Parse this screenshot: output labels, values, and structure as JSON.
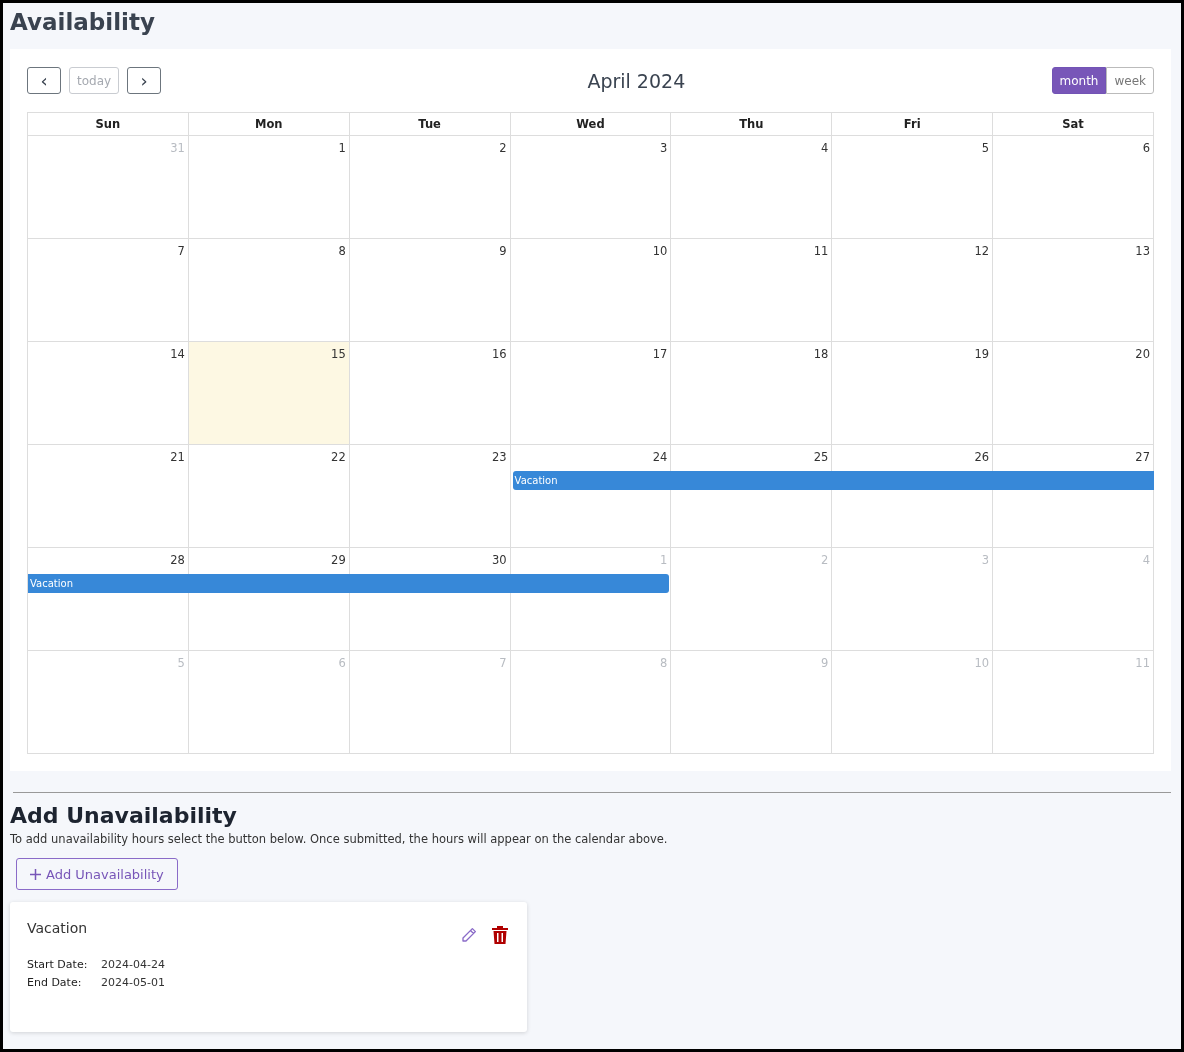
{
  "title": "Availability",
  "calendar": {
    "title": "April 2024",
    "prev_button": "‹",
    "today_button": {
      "label": "today",
      "disabled": true
    },
    "next_button": "›",
    "views": [
      {
        "label": "month",
        "selected": true
      },
      {
        "label": "week",
        "selected": false
      }
    ],
    "weekdays": [
      "Sun",
      "Mon",
      "Tue",
      "Wed",
      "Thu",
      "Fri",
      "Sat"
    ],
    "weeks": [
      {
        "days": [
          {
            "label": "31",
            "other_month": true,
            "today": false,
            "booked": false
          },
          {
            "label": "1",
            "other_month": false,
            "today": false,
            "booked": false
          },
          {
            "label": "2",
            "other_month": false,
            "today": false,
            "booked": false
          },
          {
            "label": "3",
            "other_month": false,
            "today": false,
            "booked": false
          },
          {
            "label": "4",
            "other_month": false,
            "today": false,
            "booked": false
          },
          {
            "label": "5",
            "other_month": false,
            "today": false,
            "booked": false
          },
          {
            "label": "6",
            "other_month": false,
            "today": false,
            "booked": false
          }
        ]
      },
      {
        "days": [
          {
            "label": "7",
            "other_month": false,
            "today": false,
            "booked": false
          },
          {
            "label": "8",
            "other_month": false,
            "today": false,
            "booked": false
          },
          {
            "label": "9",
            "other_month": false,
            "today": false,
            "booked": false
          },
          {
            "label": "10",
            "other_month": false,
            "today": false,
            "booked": false
          },
          {
            "label": "11",
            "other_month": false,
            "today": false,
            "booked": false
          },
          {
            "label": "12",
            "other_month": false,
            "today": false,
            "booked": false
          },
          {
            "label": "13",
            "other_month": false,
            "today": false,
            "booked": false
          }
        ]
      },
      {
        "days": [
          {
            "label": "14",
            "other_month": false,
            "today": false,
            "booked": false
          },
          {
            "label": "15",
            "other_month": false,
            "today": true,
            "booked": false
          },
          {
            "label": "16",
            "other_month": false,
            "today": false,
            "booked": false
          },
          {
            "label": "17",
            "other_month": false,
            "today": false,
            "booked": false
          },
          {
            "label": "18",
            "other_month": false,
            "today": false,
            "booked": false
          },
          {
            "label": "19",
            "other_month": false,
            "today": false,
            "booked": false
          },
          {
            "label": "20",
            "other_month": false,
            "today": false,
            "booked": false
          }
        ]
      },
      {
        "event": {
          "title": "Vacation",
          "continues_before": false,
          "continues_after": true
        },
        "days": [
          {
            "label": "21",
            "other_month": false,
            "today": false,
            "booked": false
          },
          {
            "label": "22",
            "other_month": false,
            "today": false,
            "booked": false
          },
          {
            "label": "23",
            "other_month": false,
            "today": false,
            "booked": false
          },
          {
            "label": "24",
            "other_month": false,
            "today": false,
            "booked": true
          },
          {
            "label": "25",
            "other_month": false,
            "today": false,
            "booked": true
          },
          {
            "label": "26",
            "other_month": false,
            "today": false,
            "booked": true
          },
          {
            "label": "27",
            "other_month": false,
            "today": false,
            "booked": true
          }
        ]
      },
      {
        "event": {
          "title": "Vacation",
          "continues_before": true,
          "continues_after": false
        },
        "days": [
          {
            "label": "28",
            "other_month": false,
            "today": false,
            "booked": true
          },
          {
            "label": "29",
            "other_month": false,
            "today": false,
            "booked": true
          },
          {
            "label": "30",
            "other_month": false,
            "today": false,
            "booked": true
          },
          {
            "label": "1",
            "other_month": true,
            "today": false,
            "booked": true
          },
          {
            "label": "2",
            "other_month": true,
            "today": false,
            "booked": false
          },
          {
            "label": "3",
            "other_month": true,
            "today": false,
            "booked": false
          },
          {
            "label": "4",
            "other_month": true,
            "today": false,
            "booked": false
          }
        ]
      },
      {
        "days": [
          {
            "label": "5",
            "other_month": true,
            "today": false,
            "booked": false
          },
          {
            "label": "6",
            "other_month": true,
            "today": false,
            "booked": false
          },
          {
            "label": "7",
            "other_month": true,
            "today": false,
            "booked": false
          },
          {
            "label": "8",
            "other_month": true,
            "today": false,
            "booked": false
          },
          {
            "label": "9",
            "other_month": true,
            "today": false,
            "booked": false
          },
          {
            "label": "10",
            "other_month": true,
            "today": false,
            "booked": false
          },
          {
            "label": "11",
            "other_month": true,
            "today": false,
            "booked": false
          }
        ]
      }
    ]
  },
  "unavailability": {
    "heading": "Add Unavailability",
    "description": "To add unavailability hours select the button below. Once submitted, the hours will appear on the calendar above.",
    "add_button": "Add Unavailability",
    "entries": [
      {
        "title": "Vacation",
        "fields": [
          {
            "label": "Start Date:",
            "value": "2024-04-24"
          },
          {
            "label": "End Date:",
            "value": "2024-05-01"
          }
        ]
      }
    ]
  }
}
